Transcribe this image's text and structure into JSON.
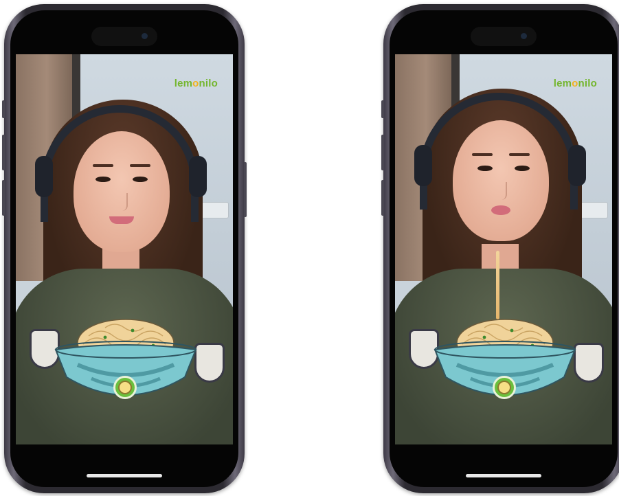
{
  "screens": [
    {
      "id": "left",
      "logo": {
        "prefix": "lem",
        "o": "o",
        "suffix": "nilo"
      },
      "state": "neutral"
    },
    {
      "id": "right",
      "logo": {
        "prefix": "lem",
        "o": "o",
        "suffix": "nilo"
      },
      "state": "slurping"
    }
  ],
  "colors": {
    "brand_green": "#74b62e",
    "brand_orange": "#f2b21d",
    "bowl": "#7cc8cf"
  }
}
